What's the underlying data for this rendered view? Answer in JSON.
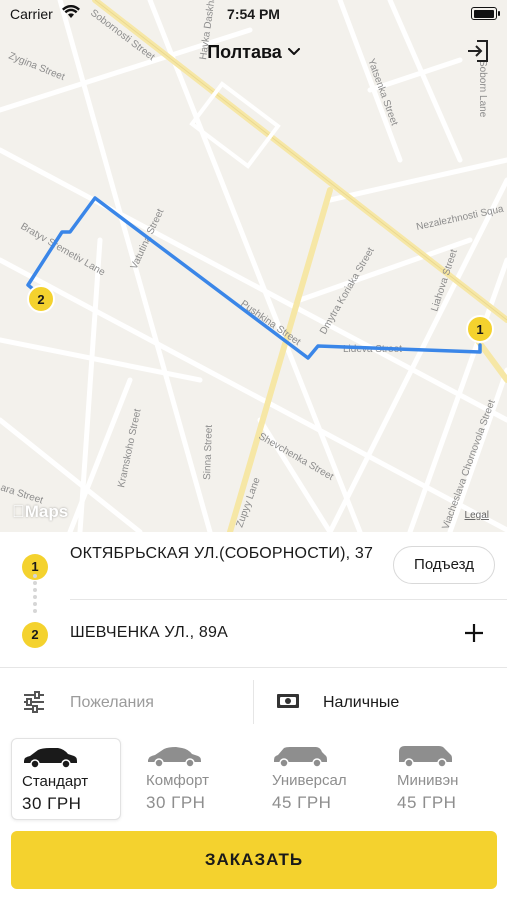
{
  "status_bar": {
    "carrier": "Carrier",
    "time": "7:54 PM",
    "battery_level": 1.0
  },
  "header": {
    "city": "Полтава",
    "city_icon": "chevron-down-icon",
    "logout_icon": "logout-icon"
  },
  "map": {
    "streets": [
      "Sobornosti Street",
      "Zygina Street",
      "Yatsenka Street",
      "Nezalezhnosti Squa",
      "Bratyv Sremetiv Lane",
      "Vatutina Street",
      "Pushkina Street",
      "Dmytra Koriaka Street",
      "Liahova Street",
      "Lideva Street",
      "Kramskoho Street",
      "Sinna Street",
      "Shevchenka Street",
      "Zupyy Lane",
      "Viacheslava Chornovola Street",
      "ara Street",
      "Havka Daskha",
      "Soborn Lane"
    ],
    "markers": [
      "1",
      "2"
    ],
    "logo": "Maps",
    "legal": "Legal",
    "route_color": "#3a86e8",
    "marker_color": "#f4d22e"
  },
  "addresses": {
    "from": {
      "number": "1",
      "text": "ОКТЯБРЬСКАЯ УЛ.(СОБОРНОСТИ), 37",
      "entrance_label": "Подъезд"
    },
    "to": {
      "number": "2",
      "text": "ШЕВЧЕНКА УЛ., 89А",
      "add_icon": "plus-icon"
    }
  },
  "options": {
    "wishes_placeholder": "Пожелания",
    "wishes_icon": "sliders-icon",
    "payment": "Наличные",
    "payment_icon": "cash-icon"
  },
  "tariffs": [
    {
      "name": "Стандарт",
      "price": "30 ГРН",
      "icon": "sedan-icon",
      "selected": true
    },
    {
      "name": "Комфорт",
      "price": "30 ГРН",
      "icon": "comfort-car-icon",
      "selected": false
    },
    {
      "name": "Универсал",
      "price": "45 ГРН",
      "icon": "wagon-icon",
      "selected": false
    },
    {
      "name": "Минивэн",
      "price": "45 ГРН",
      "icon": "minivan-icon",
      "selected": false
    }
  ],
  "order_button": "ЗАКАЗАТЬ",
  "colors": {
    "accent": "#f4d22e",
    "route": "#3a86e8"
  }
}
